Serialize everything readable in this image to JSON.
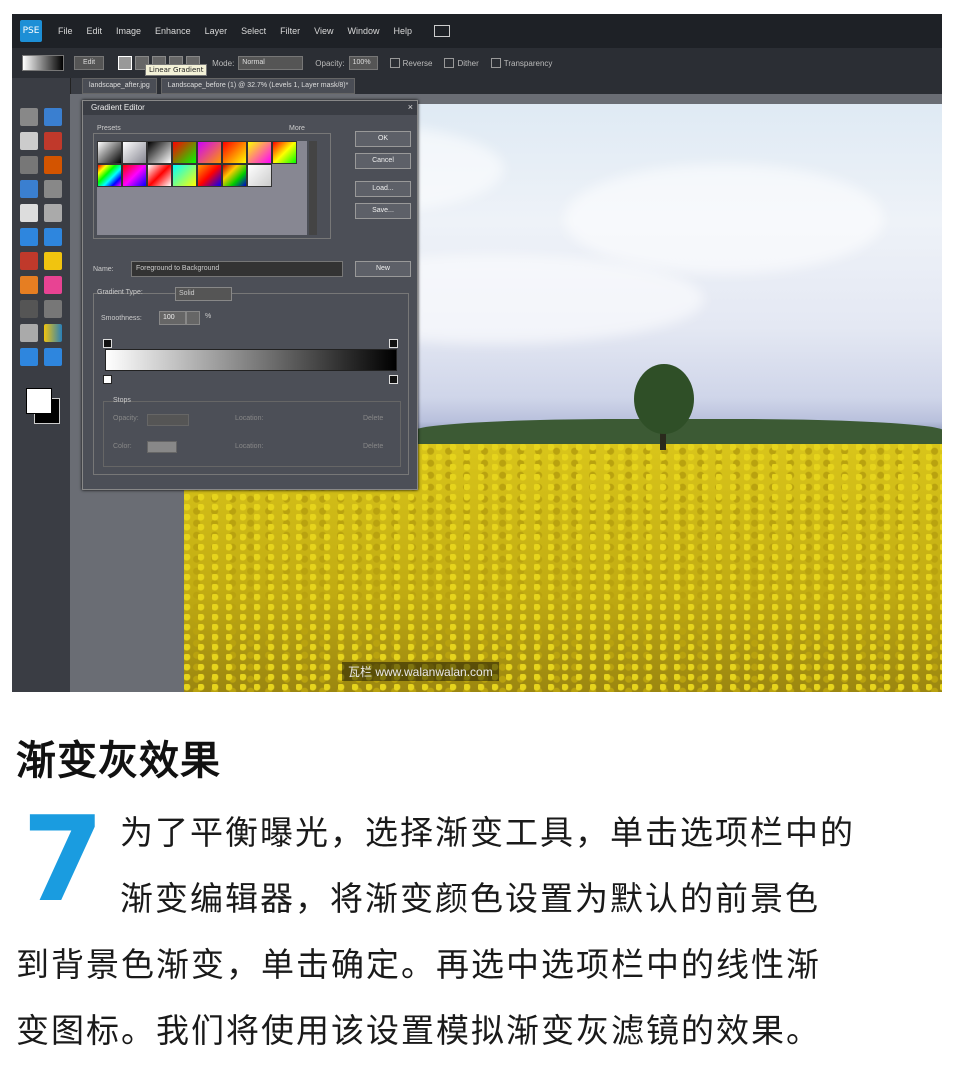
{
  "app": {
    "menu": [
      "File",
      "Edit",
      "Image",
      "Enhance",
      "Layer",
      "Select",
      "Filter",
      "View",
      "Window",
      "Help"
    ]
  },
  "options_bar": {
    "edit_label": "Edit",
    "tooltip": "Linear Gradient",
    "mode_label": "Mode:",
    "mode_value": "Normal",
    "opacity_label": "Opacity:",
    "opacity_value": "100%",
    "reverse_label": "Reverse",
    "dither_label": "Dither",
    "transparency_label": "Transparency"
  },
  "tabs": [
    "landscape_after.jpg",
    "Landscape_before (1) @ 32.7% (Levels 1, Layer mask/8)*"
  ],
  "gradient_editor": {
    "title": "Gradient Editor",
    "presets_label": "Presets",
    "more_label": "More",
    "ok_label": "OK",
    "cancel_label": "Cancel",
    "load_label": "Load...",
    "save_label": "Save...",
    "name_label": "Name:",
    "name_value": "Foreground to Background",
    "new_label": "New",
    "gradient_type_label": "Gradient Type:",
    "gradient_type_value": "Solid",
    "smoothness_label": "Smoothness:",
    "smoothness_value": "100",
    "smoothness_unit": "%",
    "stops_label": "Stops",
    "opacity_label": "Opacity:",
    "location_label": "Location:",
    "delete_label": "Delete",
    "color_label": "Color:"
  },
  "watermark": "瓦栏 www.walanwalan.com",
  "article": {
    "heading": "渐变灰效果",
    "step_number": "7",
    "line1": "为了平衡曝光，选择渐变工具，单击选项栏中的",
    "line2": "渐变编辑器，将渐变颜色设置为默认的前景色",
    "line3": "到背景色渐变，单击确定。再选中选项栏中的线性渐",
    "line4": "变图标。我们将使用该设置模拟渐变灰滤镜的效果。"
  }
}
